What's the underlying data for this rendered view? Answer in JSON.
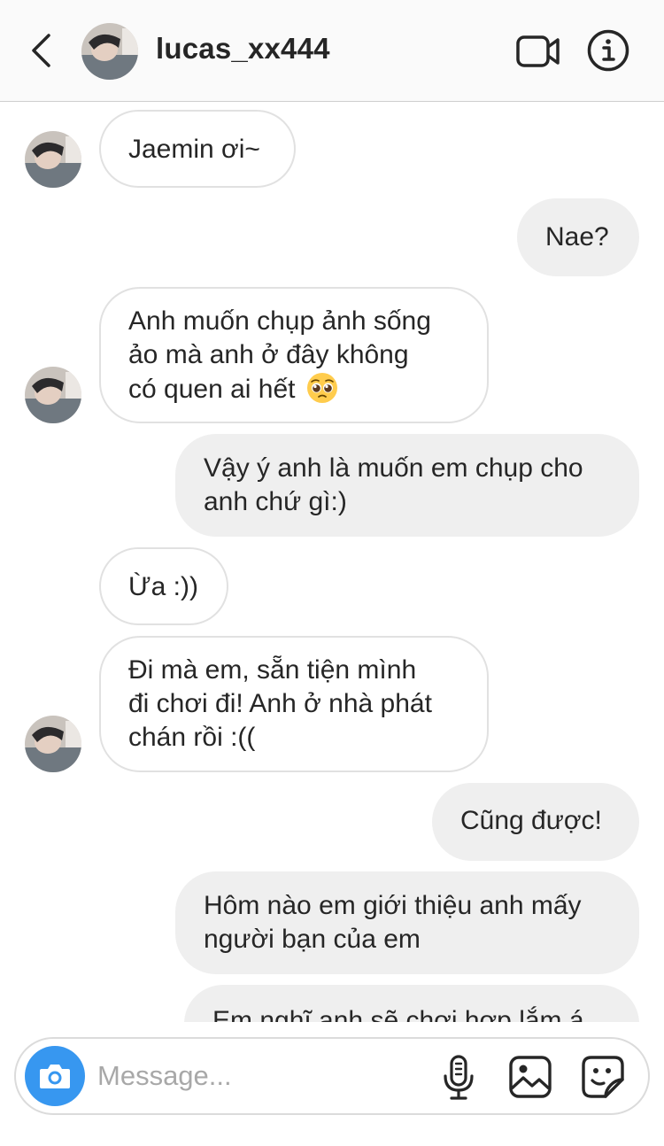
{
  "header": {
    "username": "lucas_xx444"
  },
  "messages": [
    {
      "from": "them",
      "lines": [
        "Jaemin ơi~"
      ],
      "avatar": true
    },
    {
      "from": "me",
      "lines": [
        "Nae?"
      ]
    },
    {
      "from": "them",
      "lines": [
        "Anh muốn chụp ảnh sống",
        "ảo mà anh ở đây không",
        "có quen ai hết"
      ],
      "emoji": "pleading-face",
      "avatar": true
    },
    {
      "from": "me",
      "lines": [
        "Vậy ý anh là muốn em chụp cho",
        "anh chứ gì:)"
      ]
    },
    {
      "from": "them",
      "lines": [
        "Ừa :))"
      ],
      "avatar": false
    },
    {
      "from": "them",
      "lines": [
        "Đi mà em, sẵn tiện mình",
        "đi chơi đi! Anh ở nhà phát",
        "chán rồi :(("
      ],
      "avatar": true
    },
    {
      "from": "me",
      "lines": [
        "Cũng được!"
      ]
    },
    {
      "from": "me",
      "lines": [
        "Hôm nào em giới thiệu anh mấy",
        "người bạn của em"
      ]
    },
    {
      "from": "me",
      "lines": [
        "Em nghĩ anh sẽ chơi hợp lắm á"
      ]
    }
  ],
  "composer": {
    "placeholder": "Message..."
  },
  "icons": {
    "back": "chevron-left-icon",
    "video": "video-camera-icon",
    "info": "info-icon",
    "camera": "camera-icon",
    "mic": "microphone-icon",
    "gallery": "image-gallery-icon",
    "sticker": "sticker-icon"
  },
  "colors": {
    "accent": "#3797f0",
    "incoming_bg": "#ffffff",
    "outgoing_bg": "#efefef",
    "incoming_border": "#e1e1e1"
  }
}
